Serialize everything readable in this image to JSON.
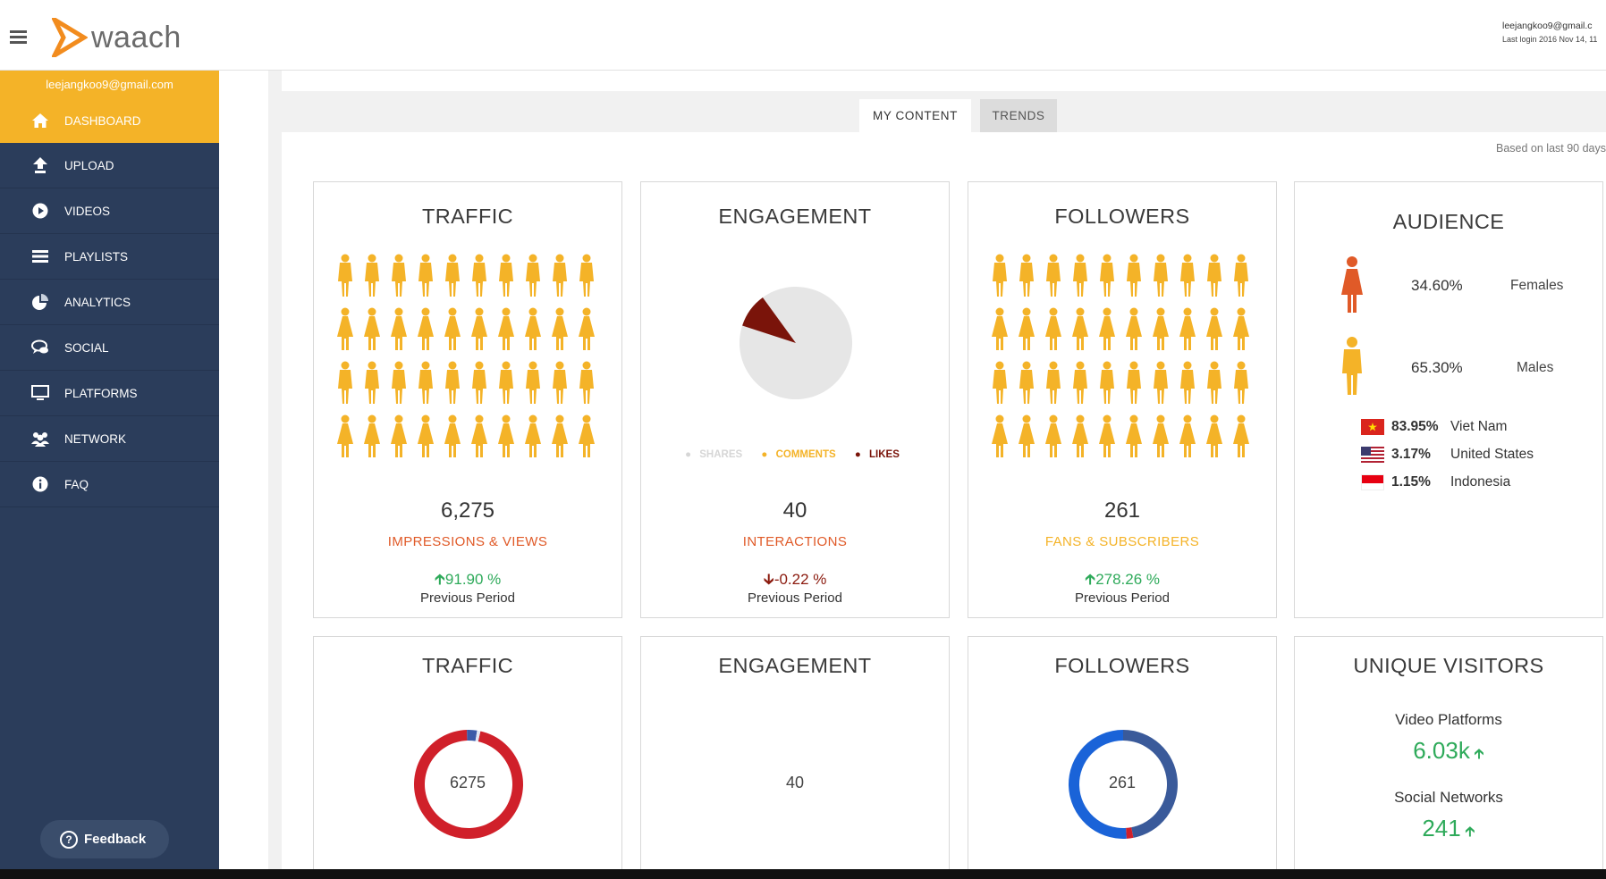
{
  "header": {
    "brand": "waach",
    "user_email": "leejangkoo9@gmail.c",
    "last_login": "Last login 2016 Nov 14, 11"
  },
  "sidebar": {
    "email": "leejangkoo9@gmail.com",
    "items": [
      {
        "label": "DASHBOARD",
        "icon": "home-icon"
      },
      {
        "label": "UPLOAD",
        "icon": "upload-icon"
      },
      {
        "label": "VIDEOS",
        "icon": "play-icon"
      },
      {
        "label": "PLAYLISTS",
        "icon": "list-icon"
      },
      {
        "label": "ANALYTICS",
        "icon": "pie-chart-icon"
      },
      {
        "label": "SOCIAL",
        "icon": "chat-icon"
      },
      {
        "label": "PLATFORMS",
        "icon": "monitor-icon"
      },
      {
        "label": "NETWORK",
        "icon": "users-icon"
      },
      {
        "label": "FAQ",
        "icon": "info-icon"
      }
    ],
    "feedback_label": "Feedback"
  },
  "tabs": [
    "MY CONTENT",
    "TRENDS"
  ],
  "based_on": "Based on last 90 days",
  "colors": {
    "accent": "#f4b328",
    "sidebar": "#2b3d5b",
    "orange_red": "#e05a28",
    "up": "#2eaa5a",
    "down": "#8b1a0e",
    "likes": "#7a140a"
  },
  "cards_top": {
    "traffic": {
      "title": "TRAFFIC",
      "value": "6,275",
      "label": "IMPRESSIONS & VIEWS",
      "change": "91.90 %",
      "direction": "up",
      "prev": "Previous Period"
    },
    "engagement": {
      "title": "ENGAGEMENT",
      "value": "40",
      "label": "INTERACTIONS",
      "change": "-0.22 %",
      "direction": "down",
      "prev": "Previous Period",
      "legend": [
        "SHARES",
        "COMMENTS",
        "LIKES"
      ]
    },
    "followers": {
      "title": "FOLLOWERS",
      "value": "261",
      "label": "FANS & SUBSCRIBERS",
      "change": "278.26 %",
      "direction": "up",
      "prev": "Previous Period"
    },
    "audience": {
      "title": "AUDIENCE",
      "female_pct": "34.60%",
      "female_label": "Females",
      "male_pct": "65.30%",
      "male_label": "Males",
      "countries": [
        {
          "pct": "83.95%",
          "name": "Viet Nam",
          "flag": "vietnam-flag-icon"
        },
        {
          "pct": "3.17%",
          "name": "United States",
          "flag": "us-flag-icon"
        },
        {
          "pct": "1.15%",
          "name": "Indonesia",
          "flag": "indonesia-flag-icon"
        }
      ]
    }
  },
  "cards_bottom": {
    "traffic": {
      "title": "TRAFFIC",
      "center": "6275"
    },
    "engagement": {
      "title": "ENGAGEMENT",
      "center": "40"
    },
    "followers": {
      "title": "FOLLOWERS",
      "center": "261"
    },
    "visitors": {
      "title": "UNIQUE VISITORS",
      "video_label": "Video Platforms",
      "video_value": "6.03k",
      "social_label": "Social Networks",
      "social_value": "241"
    }
  },
  "chart_data": [
    {
      "type": "pie",
      "title": "ENGAGEMENT",
      "categories": [
        "SHARES",
        "COMMENTS",
        "LIKES"
      ],
      "values": [
        90,
        0,
        10
      ],
      "colors": [
        "#e6e6e6",
        "#f4b328",
        "#7a140a"
      ]
    },
    {
      "type": "pie",
      "title": "TRAFFIC",
      "categories": [
        "red",
        "blue",
        "light"
      ],
      "values": [
        96,
        3,
        1
      ],
      "colors": [
        "#d0202a",
        "#3a5aa8",
        "#dfe6f3"
      ]
    },
    {
      "type": "pie",
      "title": "FOLLOWERS",
      "categories": [
        "navy",
        "red",
        "blue"
      ],
      "values": [
        47,
        2,
        51
      ],
      "colors": [
        "#3a5a9a",
        "#d0202a",
        "#1a63d8"
      ]
    }
  ]
}
